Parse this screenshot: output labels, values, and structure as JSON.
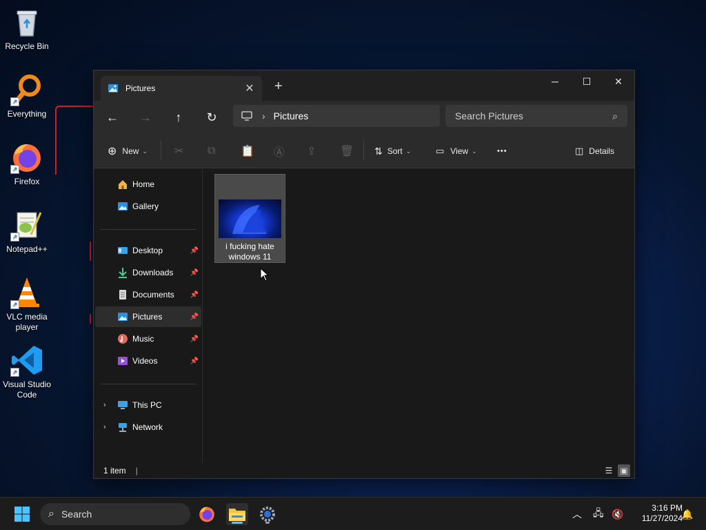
{
  "desktop": {
    "icons": [
      {
        "label": "Recycle Bin"
      },
      {
        "label": "Everything"
      },
      {
        "label": "Firefox"
      },
      {
        "label": "Notepad++"
      },
      {
        "label": "VLC media player"
      },
      {
        "label": "Visual Studio Code"
      }
    ]
  },
  "window": {
    "tab_title": "Pictures",
    "new_tab_label": "+",
    "address": {
      "current": "Pictures"
    },
    "search_placeholder": "Search Pictures",
    "toolbar": {
      "new_label": "New",
      "sort_label": "Sort",
      "view_label": "View",
      "more_label": "•••",
      "details_label": "Details"
    },
    "nav": {
      "quick": [
        {
          "label": "Home",
          "icon": "home-icon"
        },
        {
          "label": "Gallery",
          "icon": "gallery-icon"
        }
      ],
      "pinned": [
        {
          "label": "Desktop",
          "icon": "desktop-folder-icon"
        },
        {
          "label": "Downloads",
          "icon": "downloads-folder-icon"
        },
        {
          "label": "Documents",
          "icon": "documents-folder-icon"
        },
        {
          "label": "Pictures",
          "icon": "pictures-folder-icon",
          "selected": true
        },
        {
          "label": "Music",
          "icon": "music-folder-icon"
        },
        {
          "label": "Videos",
          "icon": "videos-folder-icon"
        }
      ],
      "tree": [
        {
          "label": "This PC",
          "icon": "this-pc-icon"
        },
        {
          "label": "Network",
          "icon": "network-icon"
        }
      ]
    },
    "files": [
      {
        "name": "i fucking hate windows 11"
      }
    ],
    "status": {
      "item_count": "1 item",
      "separator": "|"
    }
  },
  "taskbar": {
    "search_label": "Search",
    "clock": {
      "time": "3:16 PM",
      "date": "11/27/2024"
    }
  },
  "colors": {
    "accent": "#76b9ed",
    "selection": "#4a4a4a",
    "window_bg": "#191919"
  }
}
